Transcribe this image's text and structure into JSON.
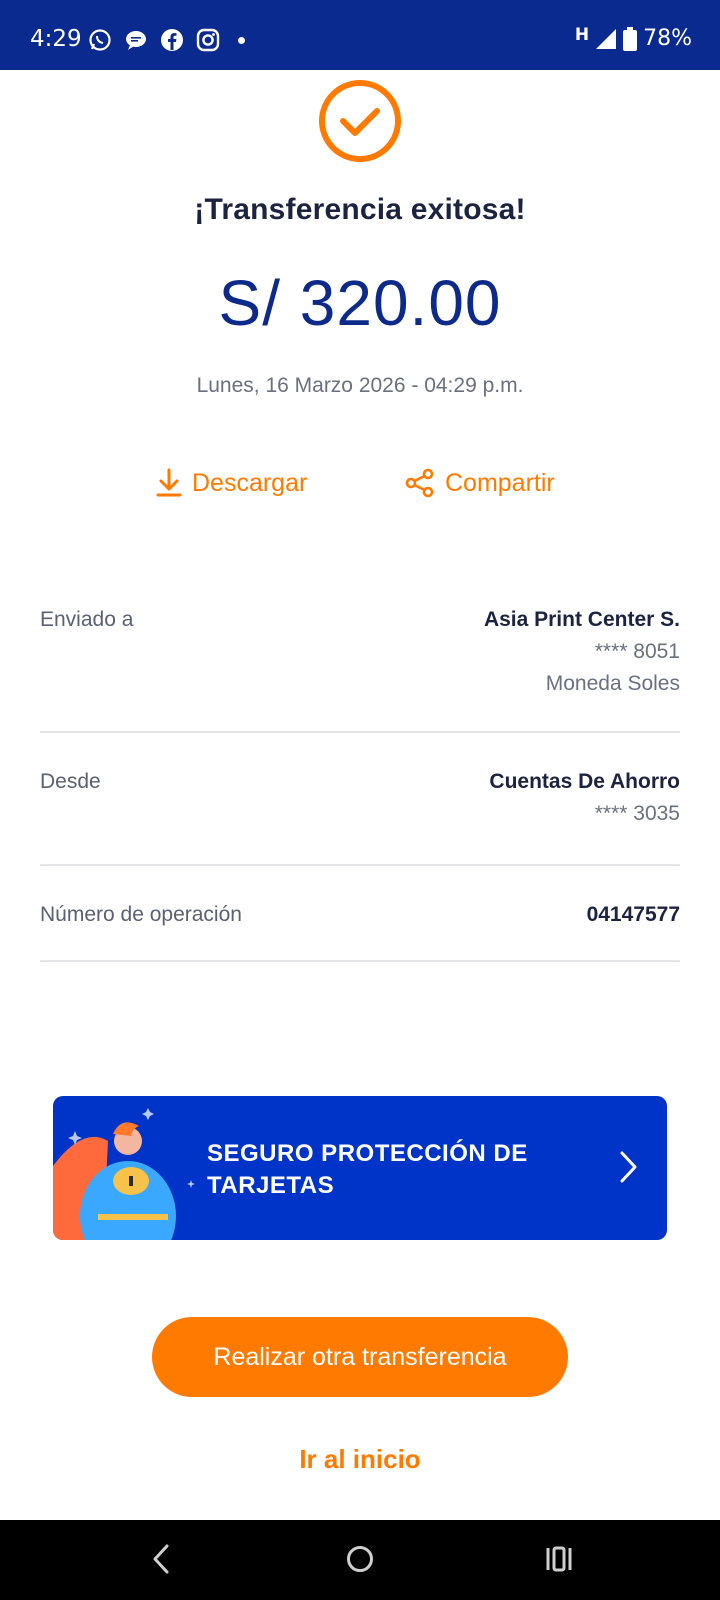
{
  "status_bar": {
    "time": "4:29",
    "network": "H",
    "battery": "78%",
    "icons": [
      "whatsapp-icon",
      "chat-bubble-icon",
      "facebook-icon",
      "instagram-icon",
      "dot-icon"
    ]
  },
  "receipt": {
    "title": "¡Transferencia exitosa!",
    "amount": "S/ 320.00",
    "datetime": "Lunes, 16 Marzo 2026 - 04:29 p.m."
  },
  "actions": {
    "download_label": "Descargar",
    "share_label": "Compartir"
  },
  "details": {
    "sent_to_label": "Enviado a",
    "sent_to_name": "Asia Print Center S.",
    "sent_to_account": "**** 8051",
    "sent_to_currency": "Moneda Soles",
    "from_label": "Desde",
    "from_name": "Cuentas De Ahorro",
    "from_account": "**** 3035",
    "operation_label": "Número de operación",
    "operation_number": "04147577"
  },
  "banner": {
    "line1": "SEGURO PROTECCIÓN DE",
    "line2": "TARJETAS"
  },
  "buttons": {
    "primary": "Realizar otra transferencia",
    "secondary": "Ir al inicio"
  },
  "colors": {
    "brand_blue": "#0a2a8f",
    "amount_blue": "#0d2a8a",
    "banner_blue": "#0033c8",
    "accent_orange": "#ff7a00"
  }
}
